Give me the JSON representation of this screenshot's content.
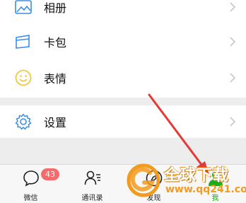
{
  "menu": {
    "items": [
      {
        "label": "相册",
        "icon": "photo-album-icon"
      },
      {
        "label": "卡包",
        "icon": "card-wallet-icon"
      },
      {
        "label": "表情",
        "icon": "smiley-icon"
      },
      {
        "label": "设置",
        "icon": "gear-icon"
      }
    ]
  },
  "tabbar": {
    "tabs": [
      {
        "label": "微信",
        "icon": "chat-bubble-icon",
        "badge": "43"
      },
      {
        "label": "通讯录",
        "icon": "contacts-icon"
      },
      {
        "label": "发现",
        "icon": "compass-icon"
      },
      {
        "label": "我",
        "icon": "person-icon",
        "active": true
      }
    ]
  },
  "watermark": {
    "title": "全球下载",
    "url": "www.qq241.com"
  },
  "colors": {
    "accent_icon": "#3a8ee6",
    "smiley": "#f4c542",
    "badge": "#f56a6a",
    "arrow": "#e53935",
    "active_tab": "#1aad19",
    "watermark_orange": "#f29b1f"
  }
}
